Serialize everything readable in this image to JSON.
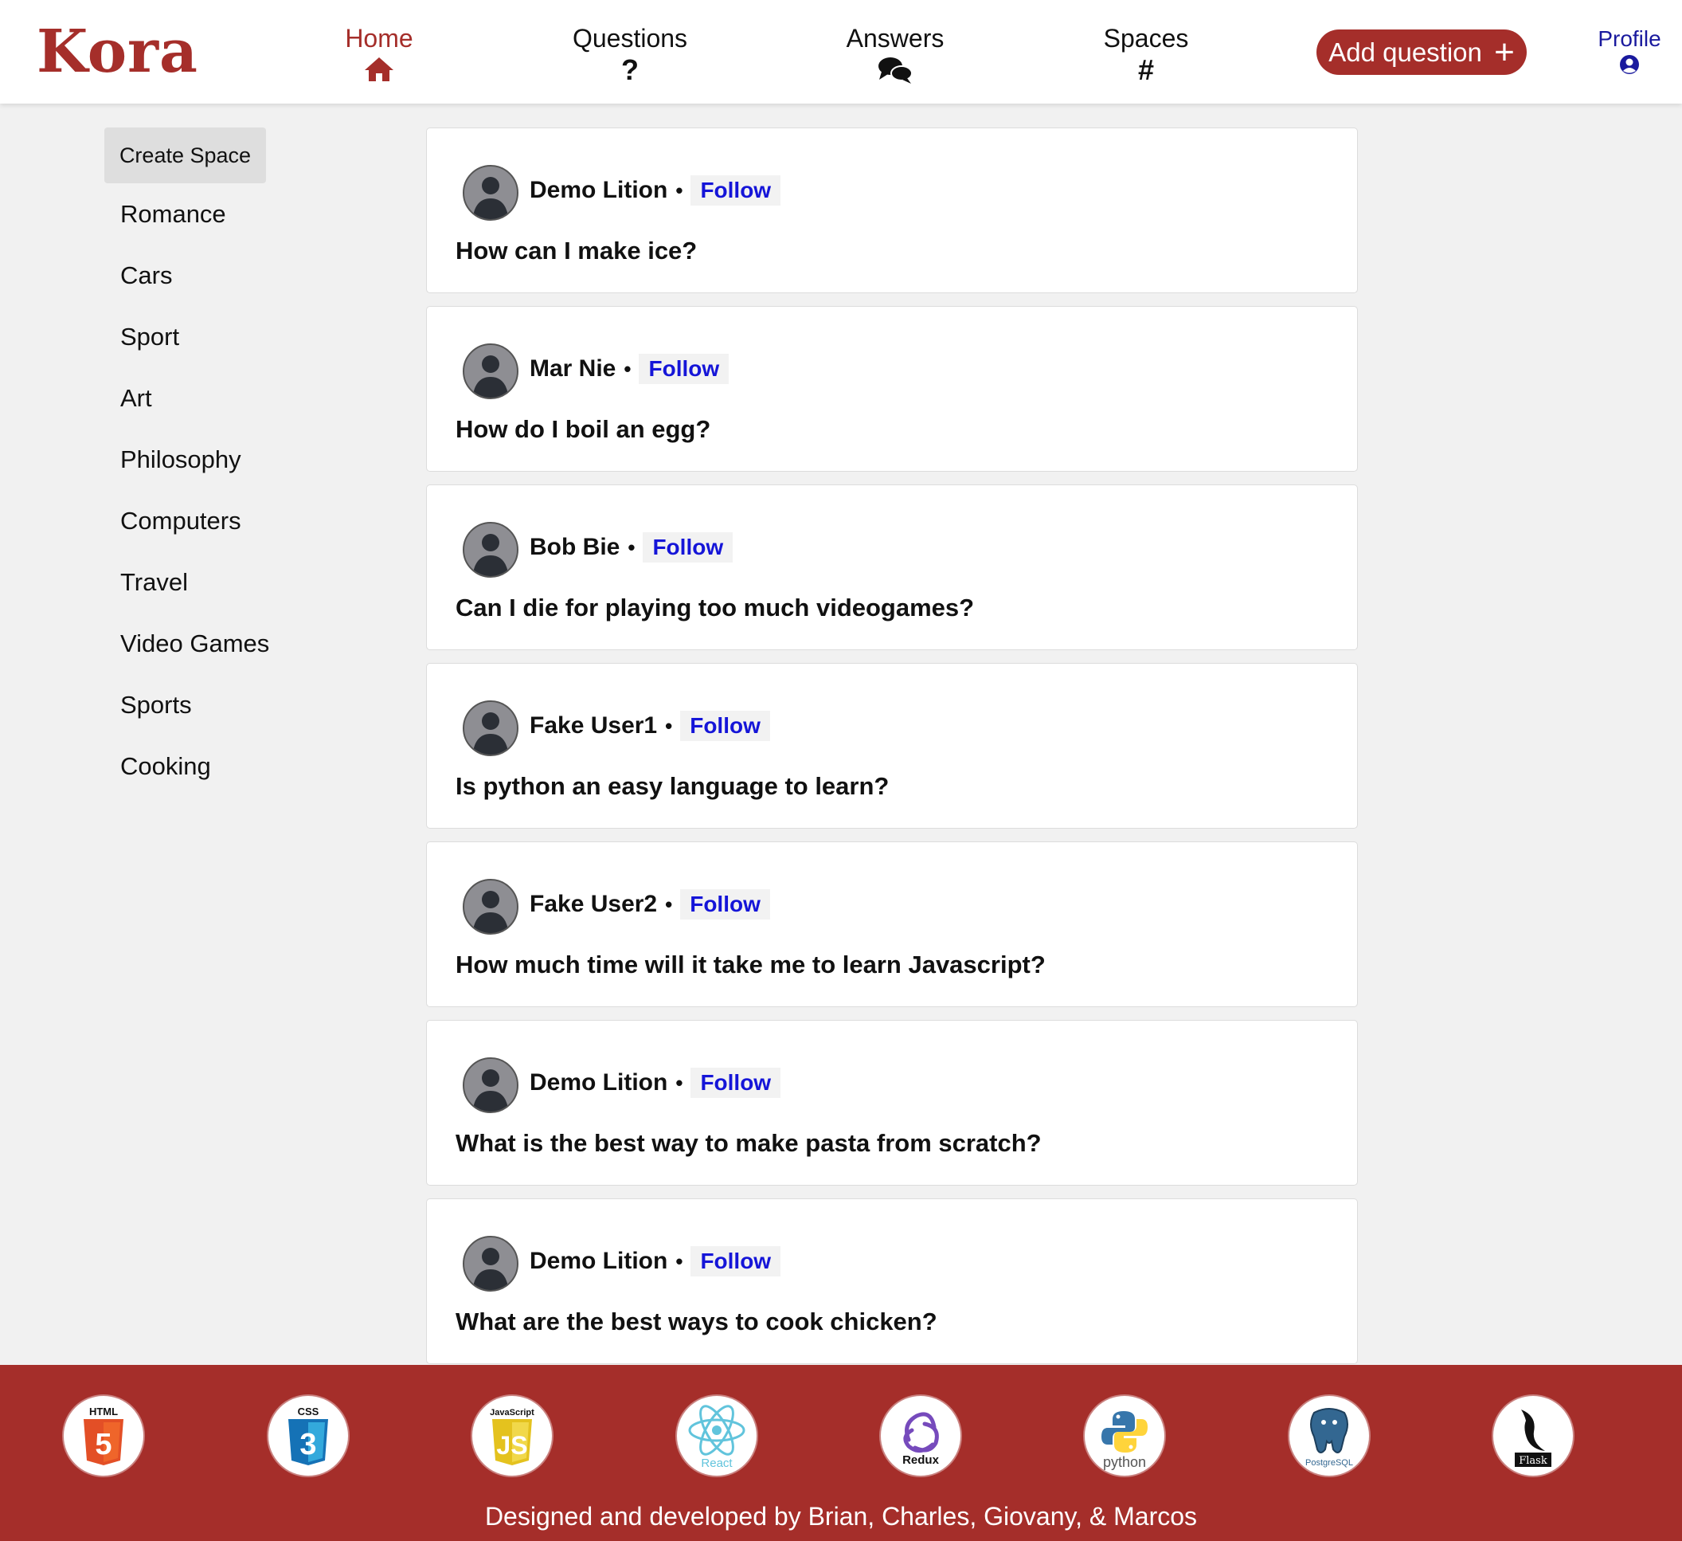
{
  "app": {
    "logo": "Kora"
  },
  "nav": {
    "home": "Home",
    "questions": "Questions",
    "questions_icon": "?",
    "answers": "Answers",
    "spaces": "Spaces",
    "spaces_icon": "#",
    "add_question": "Add question",
    "add_question_icon": "+",
    "profile": "Profile"
  },
  "colors": {
    "brand": "#a52e2a",
    "follow": "#1515d8",
    "profile": "#1a1a9e"
  },
  "sidebar": {
    "create_space": "Create Space",
    "spaces": [
      "Romance",
      "Cars",
      "Sport",
      "Art",
      "Philosophy",
      "Computers",
      "Travel",
      "Video Games",
      "Sports",
      "Cooking"
    ]
  },
  "feed": [
    {
      "author": "Demo Lition",
      "follow": "Follow",
      "question": "How can I make ice?"
    },
    {
      "author": "Mar Nie",
      "follow": "Follow",
      "question": "How do I boil an egg?"
    },
    {
      "author": "Bob Bie",
      "follow": "Follow",
      "question": "Can I die for playing too much videogames?"
    },
    {
      "author": "Fake User1",
      "follow": "Follow",
      "question": "Is python an easy language to learn?"
    },
    {
      "author": "Fake User2",
      "follow": "Follow",
      "question": "How much time will it take me to learn Javascript?"
    },
    {
      "author": "Demo Lition",
      "follow": "Follow",
      "question": "What is the best way to make pasta from scratch?"
    },
    {
      "author": "Demo Lition",
      "follow": "Follow",
      "question": "What are the best ways to cook chicken?"
    }
  ],
  "footer": {
    "tech": [
      {
        "name": "html5-logo",
        "label": "HTML"
      },
      {
        "name": "css3-logo",
        "label": "CSS"
      },
      {
        "name": "javascript-logo",
        "label": "JavaScript"
      },
      {
        "name": "react-logo",
        "label": "React"
      },
      {
        "name": "redux-logo",
        "label": "Redux"
      },
      {
        "name": "python-logo",
        "label": "python"
      },
      {
        "name": "postgresql-logo",
        "label": "PostgreSQL"
      },
      {
        "name": "flask-logo",
        "label": "Flask"
      }
    ],
    "credits": "Designed and developed by Brian, Charles, Giovany, & Marcos"
  }
}
